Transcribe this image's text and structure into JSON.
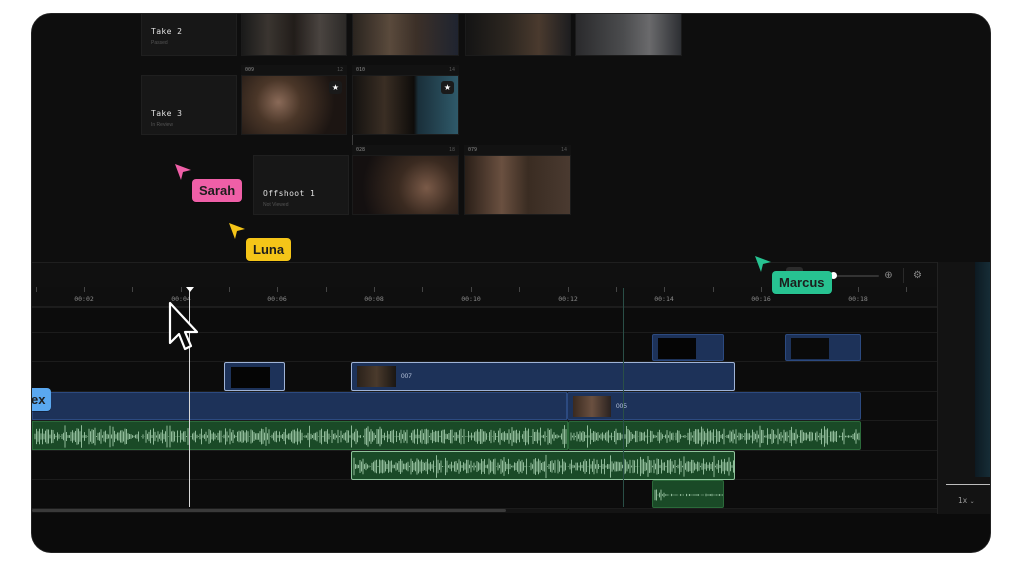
{
  "takes": {
    "take2": {
      "title": "Take 2",
      "subtitle": "Passed"
    },
    "take3": {
      "title": "Take 3",
      "subtitle": "In Review"
    },
    "offshoot1": {
      "title": "Offshoot 1",
      "subtitle": "Not Viewed"
    }
  },
  "clip_headers": [
    {
      "id": "009",
      "count": "12"
    },
    {
      "id": "010",
      "count": "14"
    },
    {
      "id": "028",
      "count": "18"
    },
    {
      "id": "079",
      "count": "14"
    }
  ],
  "collaborators": [
    {
      "name": "Sarah",
      "color": "#ef5fa7"
    },
    {
      "name": "Luna",
      "color": "#f5c518"
    },
    {
      "name": "Marcus",
      "color": "#27c291"
    },
    {
      "name": "Alex",
      "color": "#5aa8f0",
      "visible_text": "ex"
    }
  ],
  "ruler": {
    "labels": [
      "00:02",
      "00:04",
      "00:06",
      "00:08",
      "00:10",
      "00:12",
      "00:14",
      "00:16",
      "00:18"
    ]
  },
  "clips": {
    "clip_007": "007",
    "clip_005": "005"
  },
  "side": {
    "speed": "1x"
  },
  "colors": {
    "video_clip": "#1d3259",
    "audio_clip": "#1a4a27",
    "background": "#0b0b0b"
  },
  "icons": [
    "star-icon",
    "zoom-out-icon",
    "zoom-in-icon",
    "settings-icon",
    "chevron-down-icon",
    "mouse-pointer-icon"
  ]
}
